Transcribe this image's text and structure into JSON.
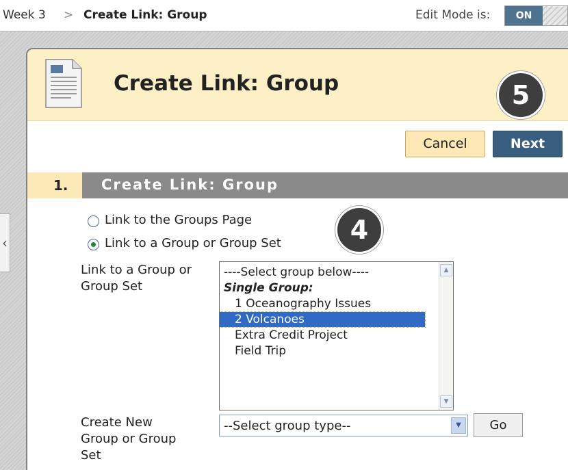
{
  "breadcrumb": {
    "parent": "Week 3",
    "separator": ">",
    "current": "Create Link: Group"
  },
  "edit_mode": {
    "label": "Edit Mode is:",
    "state": "ON"
  },
  "page": {
    "title": "Create Link: Group",
    "cancel_label": "Cancel",
    "next_label": "Next"
  },
  "step": {
    "number": "1.",
    "title": "Create Link: Group"
  },
  "radios": [
    {
      "label": "Link to the Groups Page",
      "checked": false
    },
    {
      "label": "Link to a Group or Group Set",
      "checked": true
    }
  ],
  "group_field": {
    "label_line1": "Link to a Group or",
    "label_line2": "Group Set",
    "items": [
      {
        "text": "----Select group below----"
      },
      {
        "text": "Single Group:"
      },
      {
        "text": "1 Oceanography Issues"
      },
      {
        "text": "2 Volcanoes"
      },
      {
        "text": "Extra Credit Project"
      },
      {
        "text": "Field Trip"
      }
    ],
    "selected_index": 3
  },
  "new_group_field": {
    "label_line1": "Create New",
    "label_line2": "Group or Group",
    "label_line3": "Set",
    "select_value": "--Select group type--",
    "go_label": "Go"
  },
  "callouts": [
    "4",
    "5"
  ],
  "colors": {
    "title_bar": "#fdf0c6",
    "next_button": "#3a5e80",
    "step_header": "#8a8a8a",
    "selected_item": "#316ac5"
  }
}
